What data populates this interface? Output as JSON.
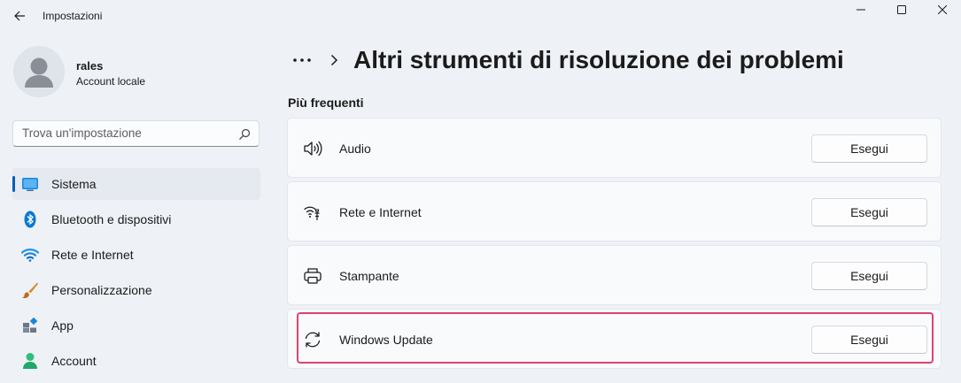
{
  "window": {
    "title": "Impostazioni"
  },
  "user": {
    "name": "rales",
    "account_type": "Account locale"
  },
  "search": {
    "placeholder": "Trova un'impostazione"
  },
  "sidebar": {
    "items": [
      {
        "label": "Sistema",
        "icon": "system-icon",
        "selected": true
      },
      {
        "label": "Bluetooth e dispositivi",
        "icon": "bluetooth-icon",
        "selected": false
      },
      {
        "label": "Rete e Internet",
        "icon": "wifi-icon",
        "selected": false
      },
      {
        "label": "Personalizzazione",
        "icon": "brush-icon",
        "selected": false
      },
      {
        "label": "App",
        "icon": "apps-icon",
        "selected": false
      },
      {
        "label": "Account",
        "icon": "account-icon",
        "selected": false
      }
    ]
  },
  "header": {
    "more": "···",
    "title": "Altri strumenti di risoluzione dei problemi"
  },
  "section": {
    "title": "Più frequenti"
  },
  "troubleshooters": [
    {
      "label": "Audio",
      "icon": "speaker-icon",
      "button": "Esegui"
    },
    {
      "label": "Rete e Internet",
      "icon": "network-icon",
      "button": "Esegui"
    },
    {
      "label": "Stampante",
      "icon": "printer-icon",
      "button": "Esegui"
    },
    {
      "label": "Windows Update",
      "icon": "refresh-icon",
      "button": "Esegui",
      "highlighted": true
    }
  ],
  "colors": {
    "accent": "#005fb8",
    "highlight": "#e0426f"
  }
}
